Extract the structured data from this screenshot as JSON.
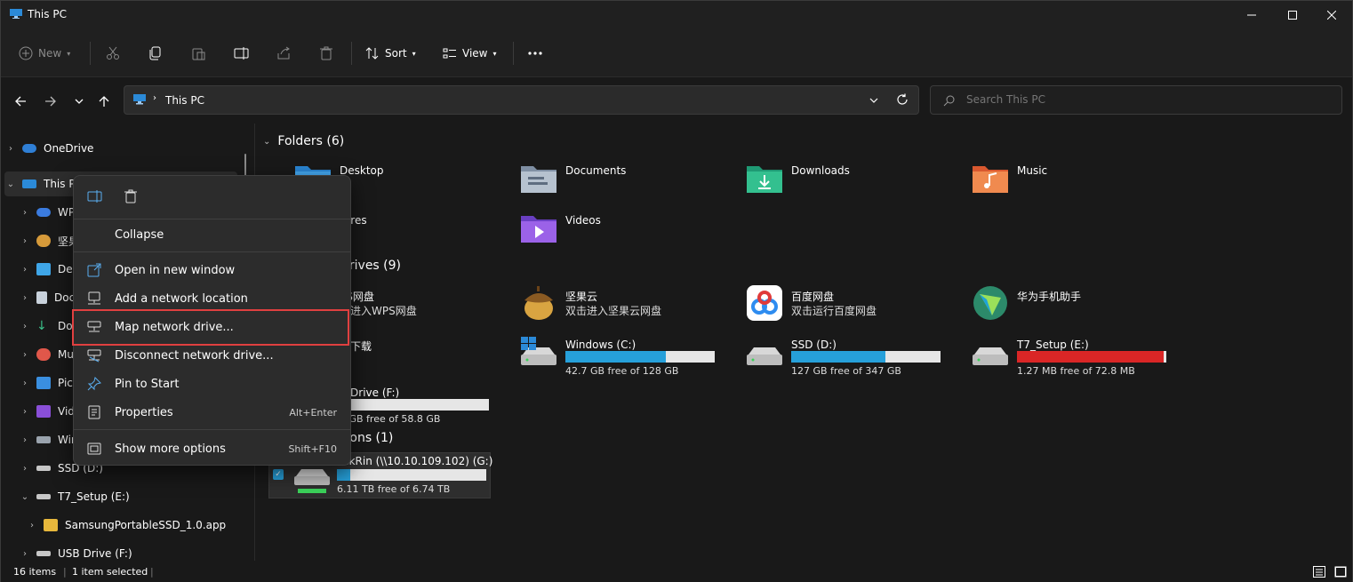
{
  "window": {
    "title": "This PC"
  },
  "toolbar": {
    "new_label": "New",
    "sort_label": "Sort",
    "view_label": "View"
  },
  "nav": {
    "breadcrumb": "This PC",
    "search_placeholder": "Search This PC"
  },
  "sidebar": {
    "items": [
      {
        "label": "OneDrive"
      },
      {
        "label": "This PC"
      },
      {
        "label": "WPS"
      },
      {
        "label": "坚果"
      },
      {
        "label": "Desk"
      },
      {
        "label": "Doc"
      },
      {
        "label": "Dow"
      },
      {
        "label": "Mus"
      },
      {
        "label": "Pict"
      },
      {
        "label": "Vide"
      },
      {
        "label": "Win"
      },
      {
        "label": "SSD (D:)"
      },
      {
        "label": "T7_Setup (E:)"
      },
      {
        "label": "SamsungPortableSSD_1.0.app"
      },
      {
        "label": "USB Drive (F:)"
      }
    ]
  },
  "content": {
    "folders_header": "Folders (6)",
    "drives_header": "drives (9)",
    "locations_header": "tions (1)",
    "folders": [
      {
        "name": "Desktop"
      },
      {
        "name": "Documents"
      },
      {
        "name": "Downloads"
      },
      {
        "name": "Music"
      },
      {
        "name": "tures"
      },
      {
        "name": "Videos"
      }
    ],
    "apps": [
      {
        "name": "PS网盘",
        "sub": "击进入WPS网盘"
      },
      {
        "name": "坚果云",
        "sub": "双击进入坚果云网盘"
      },
      {
        "name": "百度网盘",
        "sub": "双击运行百度网盘"
      },
      {
        "name": "华为手机助手",
        "sub": ""
      },
      {
        "name": "雷下载",
        "sub": ""
      }
    ],
    "drives": [
      {
        "name": "Windows  (C:)",
        "free": "42.7 GB free of 128 GB",
        "used_fraction": 0.67,
        "color": "#26a0da"
      },
      {
        "name": "SSD (D:)",
        "free": "127 GB free of 347 GB",
        "used_fraction": 0.63,
        "color": "#26a0da"
      },
      {
        "name": "T7_Setup (E:)",
        "free": "1.27 MB free of 72.8 MB",
        "used_fraction": 0.98,
        "color": "#da2626"
      },
      {
        "name": "B Drive (F:)",
        "free": "9 GB free of 58.8 GB",
        "used_fraction": 0.0,
        "color": "#26a0da"
      }
    ],
    "network": {
      "name": "sakRin (\\\\10.10.109.102) (G:)",
      "free": "6.11 TB free of 6.74 TB",
      "used_fraction": 0.09
    }
  },
  "status": {
    "items": "16 items",
    "selected": "1 item selected"
  },
  "context_menu": {
    "items": [
      {
        "label": "Collapse",
        "shortcut": ""
      },
      {
        "label": "Open in new window",
        "shortcut": ""
      },
      {
        "label": "Add a network location",
        "shortcut": ""
      },
      {
        "label": "Map network drive...",
        "shortcut": ""
      },
      {
        "label": "Disconnect network drive...",
        "shortcut": ""
      },
      {
        "label": "Pin to Start",
        "shortcut": ""
      },
      {
        "label": "Properties",
        "shortcut": "Alt+Enter"
      },
      {
        "label": "Show more options",
        "shortcut": "Shift+F10"
      }
    ]
  },
  "colors": {
    "accent": "#26a0da",
    "highlight": "#e04040"
  }
}
